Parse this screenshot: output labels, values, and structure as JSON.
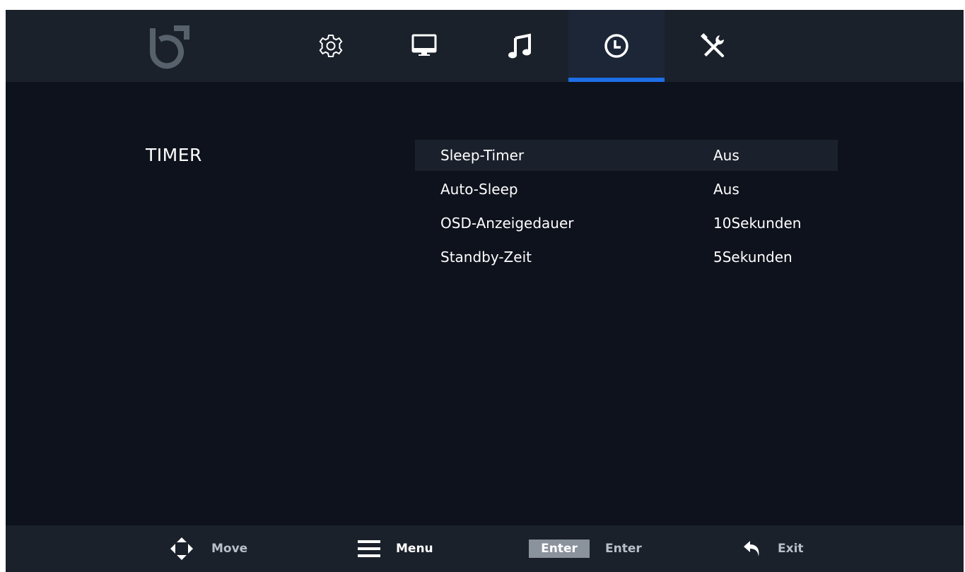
{
  "header": {
    "logo": "brand-logo",
    "tabs": [
      {
        "id": "settings",
        "icon": "gear-icon",
        "active": false
      },
      {
        "id": "picture",
        "icon": "monitor-icon",
        "active": false
      },
      {
        "id": "sound",
        "icon": "music-note-icon",
        "active": false
      },
      {
        "id": "timer",
        "icon": "clock-icon",
        "active": true
      },
      {
        "id": "tools",
        "icon": "tools-icon",
        "active": false
      }
    ],
    "active_tab_color": "#1e6ee6"
  },
  "section": {
    "title": "TIMER"
  },
  "menu": {
    "items": [
      {
        "label": "Sleep-Timer",
        "value": "Aus",
        "selected": true
      },
      {
        "label": "Auto-Sleep",
        "value": "Aus",
        "selected": false
      },
      {
        "label": "OSD-Anzeigedauer",
        "value": "10Sekunden",
        "selected": false
      },
      {
        "label": "Standby-Zeit",
        "value": "5Sekunden",
        "selected": false
      }
    ]
  },
  "footer": {
    "move": {
      "icon": "dpad-icon",
      "label": "Move"
    },
    "menu": {
      "icon": "hamburger-icon",
      "label": "Menu"
    },
    "enter": {
      "key": "Enter",
      "label": "Enter"
    },
    "exit": {
      "icon": "back-arrow-icon",
      "label": "Exit"
    }
  }
}
